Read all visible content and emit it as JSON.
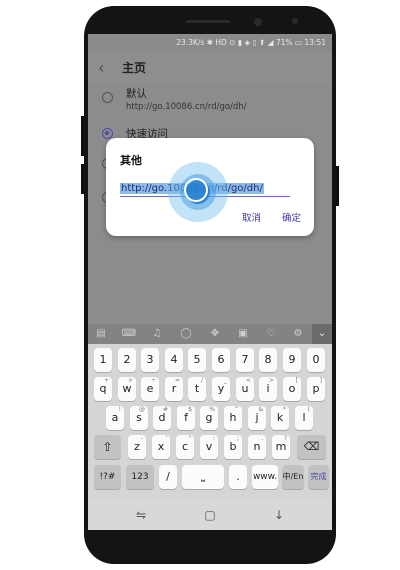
{
  "status": {
    "text": "23.3K/s ✱ HD ⊙ ▮ ◈ ▯ ⬆ ◢ 71% ▭ 13:51"
  },
  "header": {
    "back_icon": "back-arrow-icon",
    "title": "主页"
  },
  "options": [
    {
      "label": "默认",
      "sublabel": "http://go.10086.cn/rd/go/dh/",
      "selected": false
    },
    {
      "label": "快速访问",
      "sublabel": "",
      "selected": true
    },
    {
      "label": "",
      "sublabel": "",
      "selected": false
    },
    {
      "label": "",
      "sublabel": "",
      "selected": false
    }
  ],
  "dialog": {
    "title": "其他",
    "input_value": "http://go.10086.cn/rd/go/dh/",
    "cancel_label": "取消",
    "ok_label": "确定"
  },
  "keyboard_toolbar": {
    "icons": [
      "clipboard-icon",
      "keyboard-icon",
      "microphone-icon",
      "circle-icon",
      "move-icon",
      "handwriting-icon",
      "heart-sticker-icon",
      "settings-icon",
      "chevron-down-icon"
    ]
  },
  "keyboard": {
    "row1": [
      {
        "label": "1"
      },
      {
        "label": "2"
      },
      {
        "label": "3"
      },
      {
        "label": "4"
      },
      {
        "label": "5"
      },
      {
        "label": "6"
      },
      {
        "label": "7"
      },
      {
        "label": "8"
      },
      {
        "label": "9"
      },
      {
        "label": "0"
      }
    ],
    "row2": [
      {
        "label": "q",
        "symbol": "+"
      },
      {
        "label": "w",
        "symbol": "×"
      },
      {
        "label": "e",
        "symbol": "÷"
      },
      {
        "label": "r",
        "symbol": "="
      },
      {
        "label": "t",
        "symbol": "/"
      },
      {
        "label": "y",
        "symbol": "_"
      },
      {
        "label": "u",
        "symbol": "<"
      },
      {
        "label": "i",
        "symbol": ">"
      },
      {
        "label": "o",
        "symbol": "["
      },
      {
        "label": "p",
        "symbol": "]"
      }
    ],
    "row3": [
      {
        "label": "a",
        "symbol": "!"
      },
      {
        "label": "s",
        "symbol": "@"
      },
      {
        "label": "d",
        "symbol": "#"
      },
      {
        "label": "f",
        "symbol": "$"
      },
      {
        "label": "g",
        "symbol": "%"
      },
      {
        "label": "h",
        "symbol": "^"
      },
      {
        "label": "j",
        "symbol": "&"
      },
      {
        "label": "k",
        "symbol": "*"
      },
      {
        "label": "l",
        "symbol": "("
      }
    ],
    "row4": [
      {
        "label": "z",
        "symbol": "-"
      },
      {
        "label": "x",
        "symbol": "'"
      },
      {
        "label": "c",
        "symbol": "\""
      },
      {
        "label": "v",
        "symbol": ":"
      },
      {
        "label": "b",
        "symbol": ";"
      },
      {
        "label": "n",
        "symbol": ","
      },
      {
        "label": "m",
        "symbol": "?"
      }
    ],
    "shift_icon": "shift-icon",
    "backspace_icon": "backspace-icon",
    "row5": {
      "symbols": "!?#",
      "numbers": "123",
      "slash": "/",
      "space_icon": "space-icon",
      "dot": ".",
      "www": "www.",
      "lang": "中/En",
      "done": "完成"
    }
  },
  "navbar": {
    "icons": [
      "recent-apps-icon",
      "home-icon",
      "back-icon"
    ]
  },
  "colors": {
    "accent": "#4b4ca0",
    "selection": "#8fb9e8",
    "touch_indicator": "#2882d2"
  }
}
